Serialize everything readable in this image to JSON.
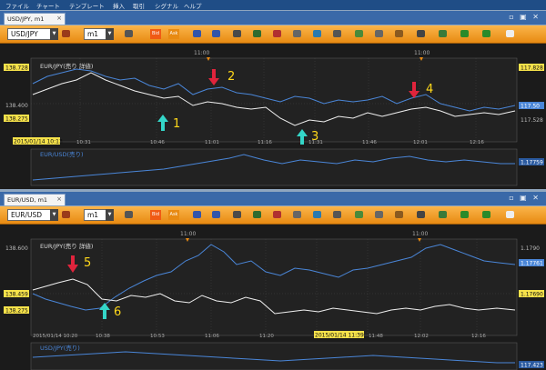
{
  "menu": [
    "ファイル",
    "チャート",
    "テンプレート",
    "挿入",
    "取引",
    "シグナル",
    "ヘルプ"
  ],
  "windows": [
    {
      "tab": "USD/JPY, m1",
      "symbol": "USD/JPY",
      "timeframe": "m1",
      "bid_label": "Bid",
      "ask_label": "Ask",
      "main_label": "EUR/JPY(売り 詳値)",
      "sub_label": "EUR/USD(売り)",
      "left_prices": [
        "138.728",
        "138.400",
        "138.275"
      ],
      "right_prices": [
        "117.828",
        "117.50",
        "117.528"
      ],
      "sub_right_price": "1.17759",
      "period_markers": [
        "11:00",
        "11:00"
      ],
      "time_ticks": [
        "10:13",
        "10:31",
        "10:46",
        "11:01",
        "11:16",
        "11:31",
        "11:46",
        "12:01",
        "12:16"
      ],
      "cursor_date": "2015/01/14 10:13",
      "annotations": [
        "1",
        "2",
        "3",
        "4"
      ]
    },
    {
      "tab": "EUR/USD, m1",
      "symbol": "EUR/USD",
      "timeframe": "m1",
      "bid_label": "Bid",
      "ask_label": "Ask",
      "main_label": "EUR/JPY(売り 詳値)",
      "sub_label": "USD/JPY(売り)",
      "left_prices": [
        "138.600",
        "138.459",
        "138.275"
      ],
      "right_prices": [
        "1.1790",
        "1.17761",
        "1.17690"
      ],
      "sub_right_price": "117.423",
      "period_markers": [
        "11:00",
        "11:00"
      ],
      "time_ticks": [
        "10:20",
        "10:38",
        "10:53",
        "11:06",
        "11:20",
        "11:35",
        "11:48",
        "12:02",
        "12:16"
      ],
      "start_date": "2015/01/14 10:20",
      "cursor_date": "2015/01/14 11:39",
      "annotations": [
        "5",
        "6"
      ]
    }
  ],
  "colors": {
    "white_series": "#f0f0f0",
    "blue_series": "#4a86d8",
    "up_arrow": "#34d6c8",
    "down_arrow": "#e0243c",
    "annotation_text": "#ffd81a",
    "toolbar": "#f4a020",
    "price_tag": "#f6e24a"
  }
}
